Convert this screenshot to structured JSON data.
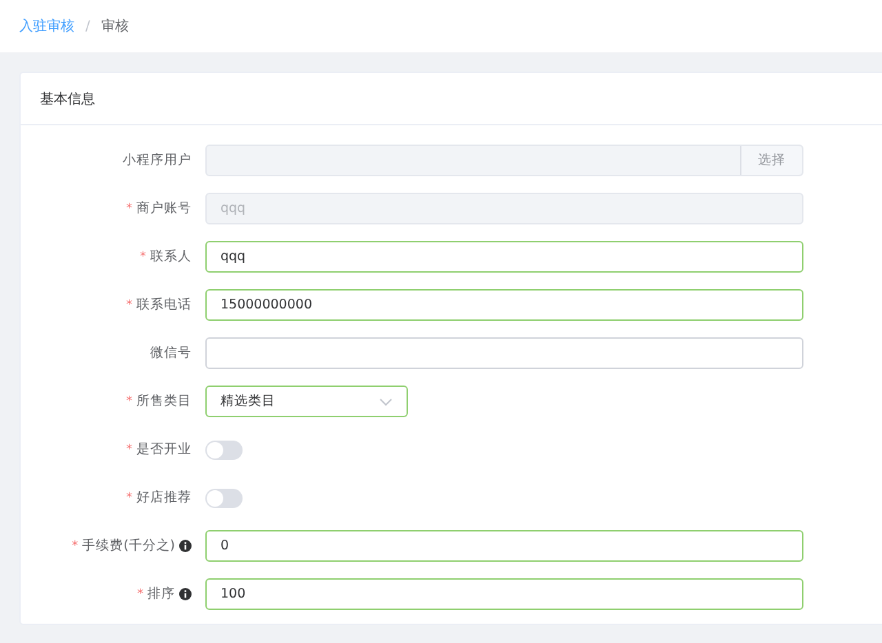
{
  "breadcrumb": [
    {
      "label": "入驻审核",
      "link": true
    },
    {
      "label": "审核",
      "link": false
    }
  ],
  "separator": "/",
  "card": {
    "title": "基本信息"
  },
  "fields": [
    {
      "kind": "text",
      "label": "小程序用户",
      "disabled": true,
      "valid": false,
      "info": false,
      "button": "选择"
    },
    {
      "kind": "text",
      "mark": "*",
      "label": "商户账号",
      "disabled": true,
      "valid": false,
      "info": false,
      "value": "qqq"
    },
    {
      "kind": "text",
      "mark": "*",
      "label": "联系人",
      "disabled": false,
      "valid": true,
      "info": false,
      "value": "qqq"
    },
    {
      "kind": "text",
      "mark": "*",
      "label": "联系电话",
      "disabled": false,
      "valid": true,
      "info": false,
      "value": "15000000000"
    },
    {
      "kind": "text",
      "label": "微信号",
      "disabled": false,
      "valid": false,
      "info": false
    },
    {
      "kind": "select",
      "mark": "*",
      "label": "所售类目",
      "disabled": false,
      "valid": true,
      "info": false,
      "value": "精选类目"
    },
    {
      "kind": "switch",
      "mark": "*",
      "label": "是否开业",
      "on": false
    },
    {
      "kind": "switch",
      "mark": "*",
      "label": "好店推荐",
      "on": false
    },
    {
      "kind": "text",
      "mark": "*",
      "label": "手续费(千分之)",
      "disabled": false,
      "valid": true,
      "info": true,
      "value": "0"
    },
    {
      "kind": "text",
      "mark": "*",
      "label": "排序",
      "disabled": false,
      "valid": true,
      "info": true,
      "value": "100"
    }
  ]
}
